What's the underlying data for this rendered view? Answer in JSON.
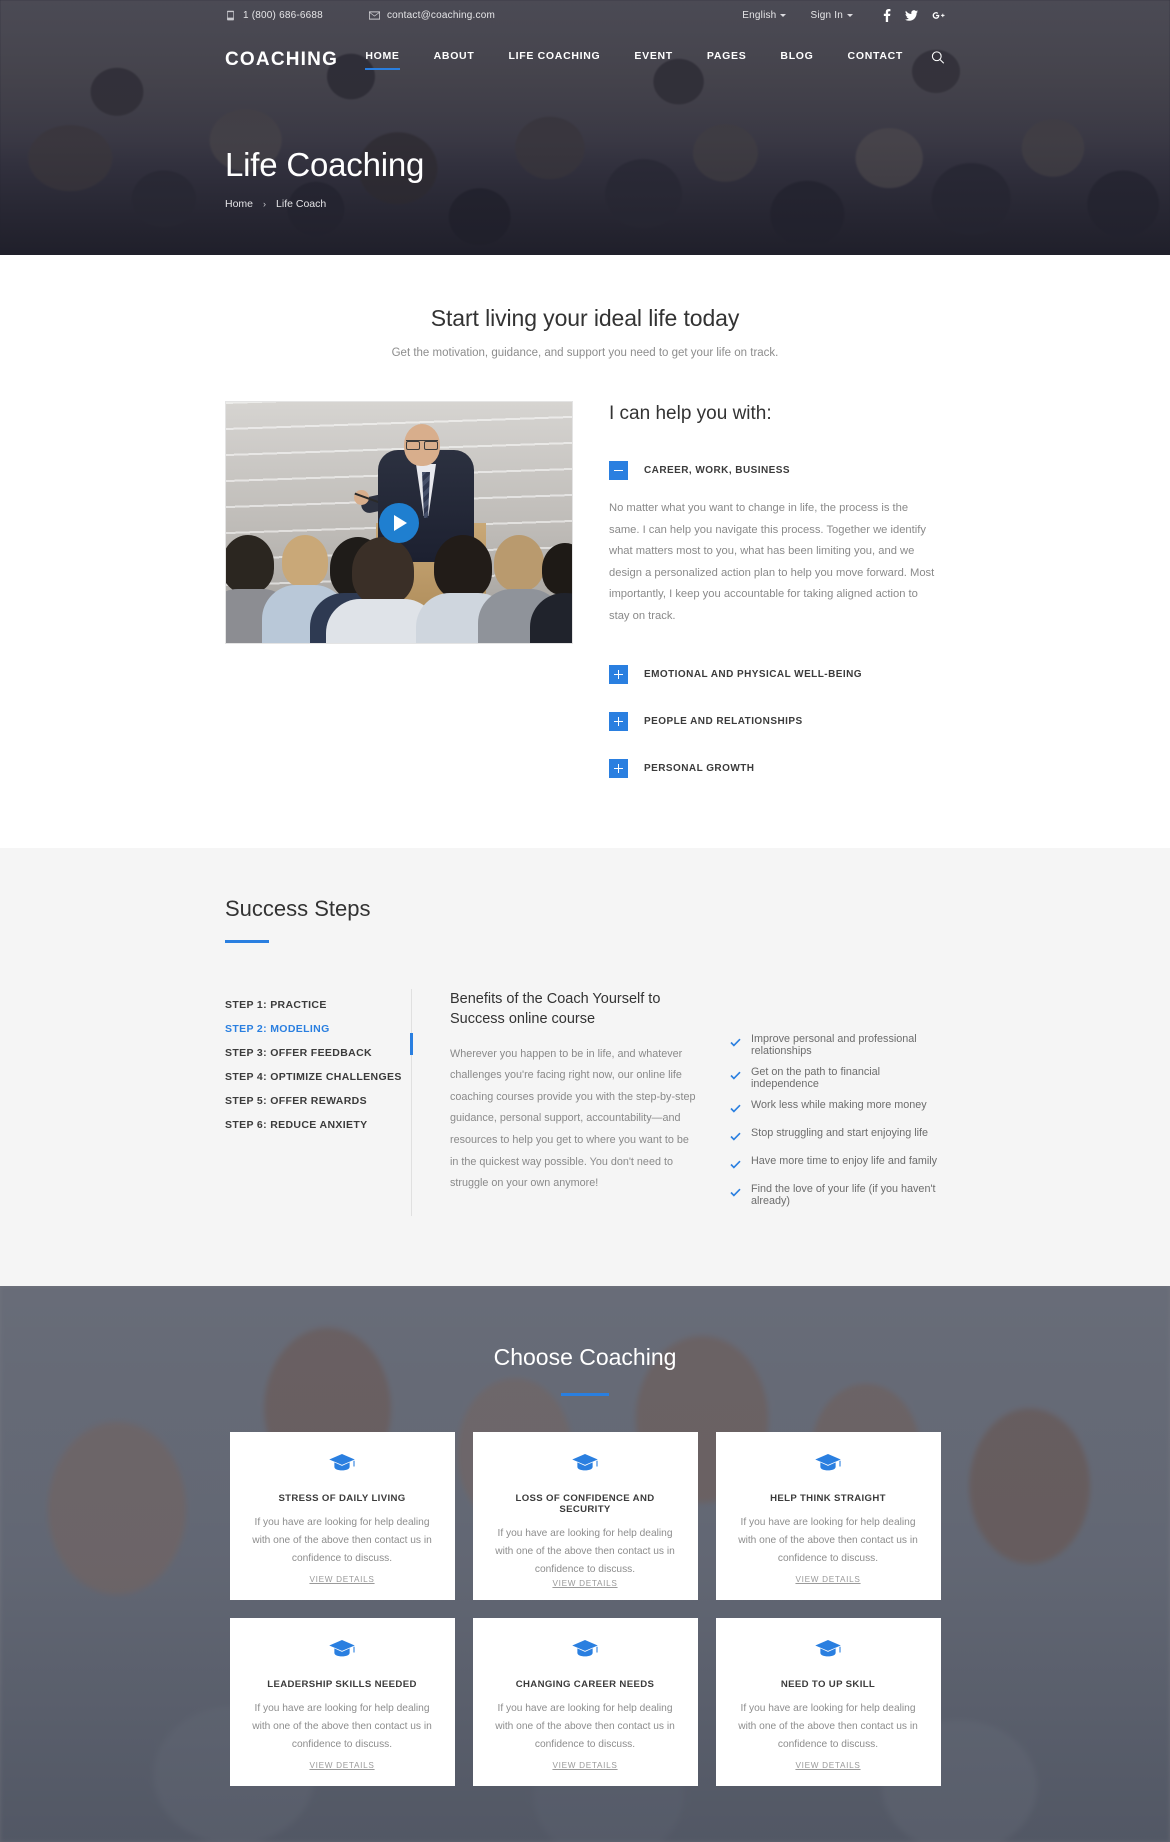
{
  "topbar": {
    "phone": "1 (800) 686-6688",
    "email": "contact@coaching.com",
    "language": "English",
    "signin": "Sign In",
    "socials": [
      "facebook-icon",
      "twitter-icon",
      "google-plus-icon"
    ]
  },
  "nav": {
    "brand": "COACHING",
    "links": [
      {
        "label": "HOME",
        "active": true
      },
      {
        "label": "ABOUT",
        "active": false
      },
      {
        "label": "LIFE COACHING",
        "active": false
      },
      {
        "label": "EVENT",
        "active": false
      },
      {
        "label": "PAGES",
        "active": false
      },
      {
        "label": "BLOG",
        "active": false
      },
      {
        "label": "CONTACT",
        "active": false
      }
    ],
    "search_icon": "search-icon"
  },
  "hero": {
    "title": "Life Coaching",
    "breadcrumb": {
      "home": "Home",
      "separator": "›",
      "current": "Life Coach"
    }
  },
  "ideal": {
    "title": "Start living your ideal life today",
    "subtitle": "Get the motivation, guidance, and support you need to get your life on track.",
    "video": {
      "play_icon": "play-icon",
      "alt": "speaker-at-podium-with-audience"
    },
    "help_title": "I can help you with:",
    "accordion": [
      {
        "label": "CAREER, WORK, BUSINESS",
        "open": true,
        "toggle": "minus-icon",
        "body": "No matter what you want to change in life, the process is the same. I can help you navigate this process. Together we identify what matters most to you, what has been limiting you, and we design a personalized action plan to help you move forward. Most importantly, I keep you accountable for taking aligned action to stay on track."
      },
      {
        "label": "EMOTIONAL AND PHYSICAL WELL-BEING",
        "open": false,
        "toggle": "plus-icon",
        "body": ""
      },
      {
        "label": "PEOPLE AND RELATIONSHIPS",
        "open": false,
        "toggle": "plus-icon",
        "body": ""
      },
      {
        "label": "PERSONAL GROWTH",
        "open": false,
        "toggle": "plus-icon",
        "body": ""
      }
    ]
  },
  "steps": {
    "title": "Success Steps",
    "items": [
      {
        "label": "STEP 1: PRACTICE",
        "active": false
      },
      {
        "label": "STEP 2: MODELING",
        "active": true
      },
      {
        "label": "STEP 3: OFFER FEEDBACK",
        "active": false
      },
      {
        "label": "STEP 4: OPTIMIZE CHALLENGES",
        "active": false
      },
      {
        "label": "STEP 5: OFFER REWARDS",
        "active": false
      },
      {
        "label": "STEP 6: REDUCE ANXIETY",
        "active": false
      }
    ],
    "benefit_title": "Benefits of the Coach Yourself to Success online course",
    "benefit_text": "Wherever you happen to be in life, and whatever challenges you're facing right now, our online life coaching courses provide you with the step-by-step guidance, personal support, accountability—and resources to help you get to where you want to be in the quickest way possible. You don't need to struggle on your own anymore!",
    "checklist": [
      "Improve personal and professional relationships",
      "Get on the path to financial independence",
      "Work less while making more money",
      "Stop struggling and start enjoying life",
      "Have more time to enjoy life and family",
      "Find the love of your life (if you haven't already)"
    ]
  },
  "choose": {
    "title": "Choose Coaching",
    "card_text": "If you have are looking for help dealing with one of the above then contact us in confidence to discuss.",
    "link_label": "VIEW DETAILS",
    "icon": "graduation-cap-icon",
    "cards": [
      {
        "title": "STRESS OF DAILY LIVING"
      },
      {
        "title": "LOSS OF CONFIDENCE AND SECURITY"
      },
      {
        "title": "HELP THINK STRAIGHT"
      },
      {
        "title": "LEADERSHIP SKILLS NEEDED"
      },
      {
        "title": "CHANGING CAREER NEEDS"
      },
      {
        "title": "NEED TO UP SKILL"
      }
    ]
  },
  "colors": {
    "accent": "#2a7fe0",
    "play_button": "#1f7fd0",
    "dark_overlay": "#2a2a38",
    "section_bg": "#f5f5f5"
  }
}
